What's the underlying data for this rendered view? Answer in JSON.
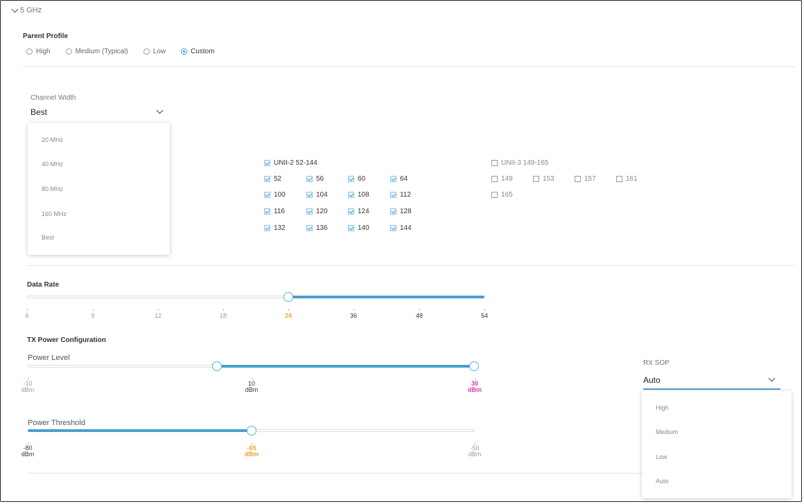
{
  "section": {
    "title": "5 GHz"
  },
  "parent_profile": {
    "label": "Parent Profile",
    "options": [
      "High",
      "Medium (Typical)",
      "Low",
      "Custom"
    ],
    "selected": "Custom"
  },
  "channel_width": {
    "label": "Channel Width",
    "value": "Best",
    "options": [
      "20 MHz",
      "40 MHz",
      "80 MHz",
      "160 MHz",
      "Best"
    ]
  },
  "channels": {
    "unii2": {
      "label": "UNII-2 52-144",
      "checked": true,
      "items": [
        "52",
        "56",
        "60",
        "64",
        "100",
        "104",
        "108",
        "112",
        "116",
        "120",
        "124",
        "128",
        "132",
        "136",
        "140",
        "144"
      ]
    },
    "unii3": {
      "label": "UNII-3 149-165",
      "checked": false,
      "items": [
        "149",
        "153",
        "157",
        "161",
        "165"
      ]
    }
  },
  "data_rate": {
    "label": "Data Rate",
    "ticks": [
      "6",
      "9",
      "12",
      "18",
      "24",
      "36",
      "48",
      "54"
    ],
    "selected_min": "24"
  },
  "tx_power": {
    "label": "TX Power Configuration",
    "power_level": {
      "label": "Power Level",
      "min": {
        "value": "-10",
        "unit": "dBm"
      },
      "mid": {
        "value": "10",
        "unit": "dBm"
      },
      "max": {
        "value": "30",
        "unit": "dBm"
      },
      "range": [
        -10,
        30
      ]
    },
    "power_threshold": {
      "label": "Power Threshold",
      "min": {
        "value": "-80",
        "unit": "dBm"
      },
      "sel": {
        "value": "-65",
        "unit": "dBm"
      },
      "max": {
        "value": "-50",
        "unit": "dBm"
      }
    }
  },
  "rx_sop": {
    "label": "RX SOP",
    "value": "Auto",
    "options": [
      "High",
      "Medium",
      "Low",
      "Auto"
    ]
  }
}
